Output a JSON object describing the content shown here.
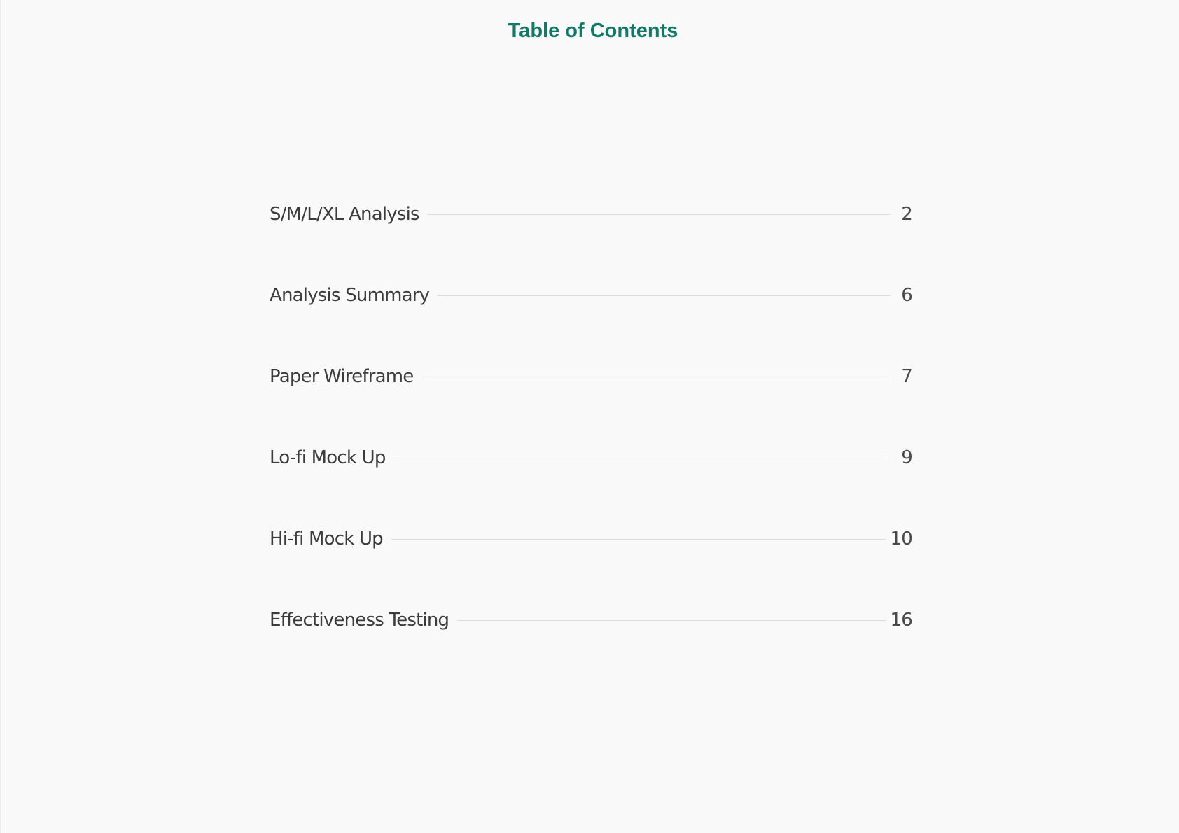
{
  "document": {
    "title": "Table of Contents",
    "accent_color": "#117a66",
    "entries": [
      {
        "label": "S/M/L/XL Analysis",
        "page": "2"
      },
      {
        "label": "Analysis Summary",
        "page": "6"
      },
      {
        "label": "Paper Wireframe",
        "page": "7"
      },
      {
        "label": "Lo-fi Mock Up",
        "page": "9"
      },
      {
        "label": "Hi-fi Mock Up",
        "page": "10"
      },
      {
        "label": "Effectiveness Testing",
        "page": "16"
      }
    ]
  }
}
